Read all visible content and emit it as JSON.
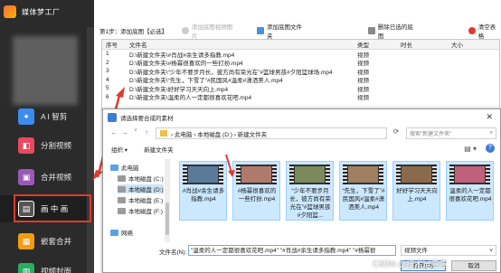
{
  "app": {
    "name": "媒体梦工厂"
  },
  "sidebar": {
    "items": [
      {
        "label": "A I 智剪",
        "icon": "ai-icon",
        "color": "#3b8cf0"
      },
      {
        "label": "分割视频",
        "icon": "split-video-icon",
        "color": "#e84a5f"
      },
      {
        "label": "合并视频",
        "icon": "merge-video-icon",
        "color": "#9b59b6"
      },
      {
        "label": "画 中 画",
        "icon": "picture-in-picture-icon",
        "color": "#444444"
      },
      {
        "label": "嵌套合并",
        "icon": "nested-merge-icon",
        "color": "#f39c12"
      },
      {
        "label": "视频封面",
        "icon": "video-cover-icon",
        "color": "#27ae60"
      }
    ],
    "active_index": 3
  },
  "toolbar": {
    "step_label": "第1步：添加底图【必选】",
    "btn_add_image": "添加底图视频图片",
    "btn_add_folder": "添加底图文件夹",
    "btn_delete": "删除已选的底图",
    "btn_clear": "清空表格"
  },
  "table": {
    "headers": [
      "序号",
      "文件名",
      "类型",
      "时长",
      "大小"
    ],
    "rows": [
      [
        "1",
        "D:\\新建文件夹\\#肖战#余生请多指教.mp4",
        "视频",
        "",
        ""
      ],
      [
        "2",
        "D:\\新建文件夹\\#杨幂很喜欢的一些打扮.mp4",
        "视频",
        "",
        ""
      ],
      [
        "3",
        "D:\\新建文件夹\\“少年不要步月长，彼方尚有荣光在”#篮球男孩#夕阳篮球场.mp4",
        "视频",
        "",
        ""
      ],
      [
        "4",
        "D:\\新建文件夹\\“先生，下雪了”#民国风#温柔#潇洒美人.mp4",
        "视频",
        "",
        ""
      ],
      [
        "5",
        "D:\\新建文件夹\\好好学习天天向上.mp4",
        "视频",
        "",
        ""
      ],
      [
        "6",
        "D:\\新建文件夹\\温柔的人一定都很喜欢花吧.mp4",
        "视频",
        "",
        ""
      ]
    ]
  },
  "dialog": {
    "title": "请选择要合成的素材",
    "breadcrumb": "› 此电脑 › 本地磁盘 (D:) › 新建文件夹",
    "search_placeholder": "搜索\"新建文件夹\"",
    "organize_label": "组织 ▾",
    "new_folder_label": "新建文件夹",
    "tree": [
      {
        "label": "此电脑",
        "icon": "computer-icon"
      },
      {
        "label": "本地磁盘 (C:)",
        "icon": "disk-icon"
      },
      {
        "label": "本地磁盘 (D:)",
        "icon": "disk-icon",
        "selected": true
      },
      {
        "label": "本地磁盘 (E:)",
        "icon": "disk-icon"
      },
      {
        "label": "本地磁盘 (F:)",
        "icon": "disk-icon"
      },
      {
        "label": "网络",
        "icon": "network-icon"
      }
    ],
    "files": [
      {
        "name": "#肖战#余生请多指教.mp4",
        "color": "#5a7a9a"
      },
      {
        "name": "#杨幂很喜欢的一些打扮.mp4",
        "color": "#b07a6a"
      },
      {
        "name": "“少年不要步月长，彼方尚有荣光在”#篮球男孩#夕阳篮...",
        "color": "#7a8a5a"
      },
      {
        "name": "“先生，下雪了”#民国风#温柔#潇洒美人.mp4",
        "color": "#a08060"
      },
      {
        "name": "好好学习天天向上.mp4",
        "color": "#8a6a4a"
      },
      {
        "name": "温柔的人一定都很喜欢花吧.mp4",
        "color": "#c0607a"
      }
    ],
    "filename_label": "文件名(N):",
    "filename_value": "\"温柔的人一定都很喜欢花吧.mp4\" \"#肖战#余生请多指教.mp4\" \"#杨幂很",
    "filetype_value": "视频文件",
    "open_label": "打开(O)",
    "cancel_label": "取消"
  },
  "watermark": "CSDN @技术是渲渲"
}
